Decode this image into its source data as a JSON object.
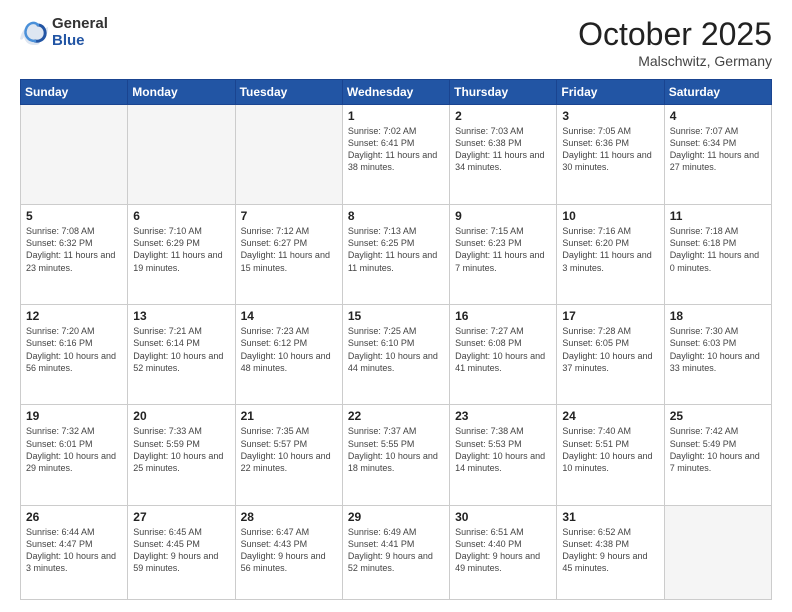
{
  "logo": {
    "general": "General",
    "blue": "Blue"
  },
  "header": {
    "month": "October 2025",
    "location": "Malschwitz, Germany"
  },
  "weekdays": [
    "Sunday",
    "Monday",
    "Tuesday",
    "Wednesday",
    "Thursday",
    "Friday",
    "Saturday"
  ],
  "weeks": [
    [
      {
        "day": "",
        "empty": true
      },
      {
        "day": "",
        "empty": true
      },
      {
        "day": "",
        "empty": true
      },
      {
        "day": "1",
        "sunrise": "7:02 AM",
        "sunset": "6:41 PM",
        "daylight": "11 hours and 38 minutes."
      },
      {
        "day": "2",
        "sunrise": "7:03 AM",
        "sunset": "6:38 PM",
        "daylight": "11 hours and 34 minutes."
      },
      {
        "day": "3",
        "sunrise": "7:05 AM",
        "sunset": "6:36 PM",
        "daylight": "11 hours and 30 minutes."
      },
      {
        "day": "4",
        "sunrise": "7:07 AM",
        "sunset": "6:34 PM",
        "daylight": "11 hours and 27 minutes."
      }
    ],
    [
      {
        "day": "5",
        "sunrise": "7:08 AM",
        "sunset": "6:32 PM",
        "daylight": "11 hours and 23 minutes."
      },
      {
        "day": "6",
        "sunrise": "7:10 AM",
        "sunset": "6:29 PM",
        "daylight": "11 hours and 19 minutes."
      },
      {
        "day": "7",
        "sunrise": "7:12 AM",
        "sunset": "6:27 PM",
        "daylight": "11 hours and 15 minutes."
      },
      {
        "day": "8",
        "sunrise": "7:13 AM",
        "sunset": "6:25 PM",
        "daylight": "11 hours and 11 minutes."
      },
      {
        "day": "9",
        "sunrise": "7:15 AM",
        "sunset": "6:23 PM",
        "daylight": "11 hours and 7 minutes."
      },
      {
        "day": "10",
        "sunrise": "7:16 AM",
        "sunset": "6:20 PM",
        "daylight": "11 hours and 3 minutes."
      },
      {
        "day": "11",
        "sunrise": "7:18 AM",
        "sunset": "6:18 PM",
        "daylight": "11 hours and 0 minutes."
      }
    ],
    [
      {
        "day": "12",
        "sunrise": "7:20 AM",
        "sunset": "6:16 PM",
        "daylight": "10 hours and 56 minutes."
      },
      {
        "day": "13",
        "sunrise": "7:21 AM",
        "sunset": "6:14 PM",
        "daylight": "10 hours and 52 minutes."
      },
      {
        "day": "14",
        "sunrise": "7:23 AM",
        "sunset": "6:12 PM",
        "daylight": "10 hours and 48 minutes."
      },
      {
        "day": "15",
        "sunrise": "7:25 AM",
        "sunset": "6:10 PM",
        "daylight": "10 hours and 44 minutes."
      },
      {
        "day": "16",
        "sunrise": "7:27 AM",
        "sunset": "6:08 PM",
        "daylight": "10 hours and 41 minutes."
      },
      {
        "day": "17",
        "sunrise": "7:28 AM",
        "sunset": "6:05 PM",
        "daylight": "10 hours and 37 minutes."
      },
      {
        "day": "18",
        "sunrise": "7:30 AM",
        "sunset": "6:03 PM",
        "daylight": "10 hours and 33 minutes."
      }
    ],
    [
      {
        "day": "19",
        "sunrise": "7:32 AM",
        "sunset": "6:01 PM",
        "daylight": "10 hours and 29 minutes."
      },
      {
        "day": "20",
        "sunrise": "7:33 AM",
        "sunset": "5:59 PM",
        "daylight": "10 hours and 25 minutes."
      },
      {
        "day": "21",
        "sunrise": "7:35 AM",
        "sunset": "5:57 PM",
        "daylight": "10 hours and 22 minutes."
      },
      {
        "day": "22",
        "sunrise": "7:37 AM",
        "sunset": "5:55 PM",
        "daylight": "10 hours and 18 minutes."
      },
      {
        "day": "23",
        "sunrise": "7:38 AM",
        "sunset": "5:53 PM",
        "daylight": "10 hours and 14 minutes."
      },
      {
        "day": "24",
        "sunrise": "7:40 AM",
        "sunset": "5:51 PM",
        "daylight": "10 hours and 10 minutes."
      },
      {
        "day": "25",
        "sunrise": "7:42 AM",
        "sunset": "5:49 PM",
        "daylight": "10 hours and 7 minutes."
      }
    ],
    [
      {
        "day": "26",
        "sunrise": "6:44 AM",
        "sunset": "4:47 PM",
        "daylight": "10 hours and 3 minutes."
      },
      {
        "day": "27",
        "sunrise": "6:45 AM",
        "sunset": "4:45 PM",
        "daylight": "9 hours and 59 minutes."
      },
      {
        "day": "28",
        "sunrise": "6:47 AM",
        "sunset": "4:43 PM",
        "daylight": "9 hours and 56 minutes."
      },
      {
        "day": "29",
        "sunrise": "6:49 AM",
        "sunset": "4:41 PM",
        "daylight": "9 hours and 52 minutes."
      },
      {
        "day": "30",
        "sunrise": "6:51 AM",
        "sunset": "4:40 PM",
        "daylight": "9 hours and 49 minutes."
      },
      {
        "day": "31",
        "sunrise": "6:52 AM",
        "sunset": "4:38 PM",
        "daylight": "9 hours and 45 minutes."
      },
      {
        "day": "",
        "empty": true
      }
    ]
  ],
  "labels": {
    "sunrise": "Sunrise:",
    "sunset": "Sunset:",
    "daylight": "Daylight hours"
  }
}
